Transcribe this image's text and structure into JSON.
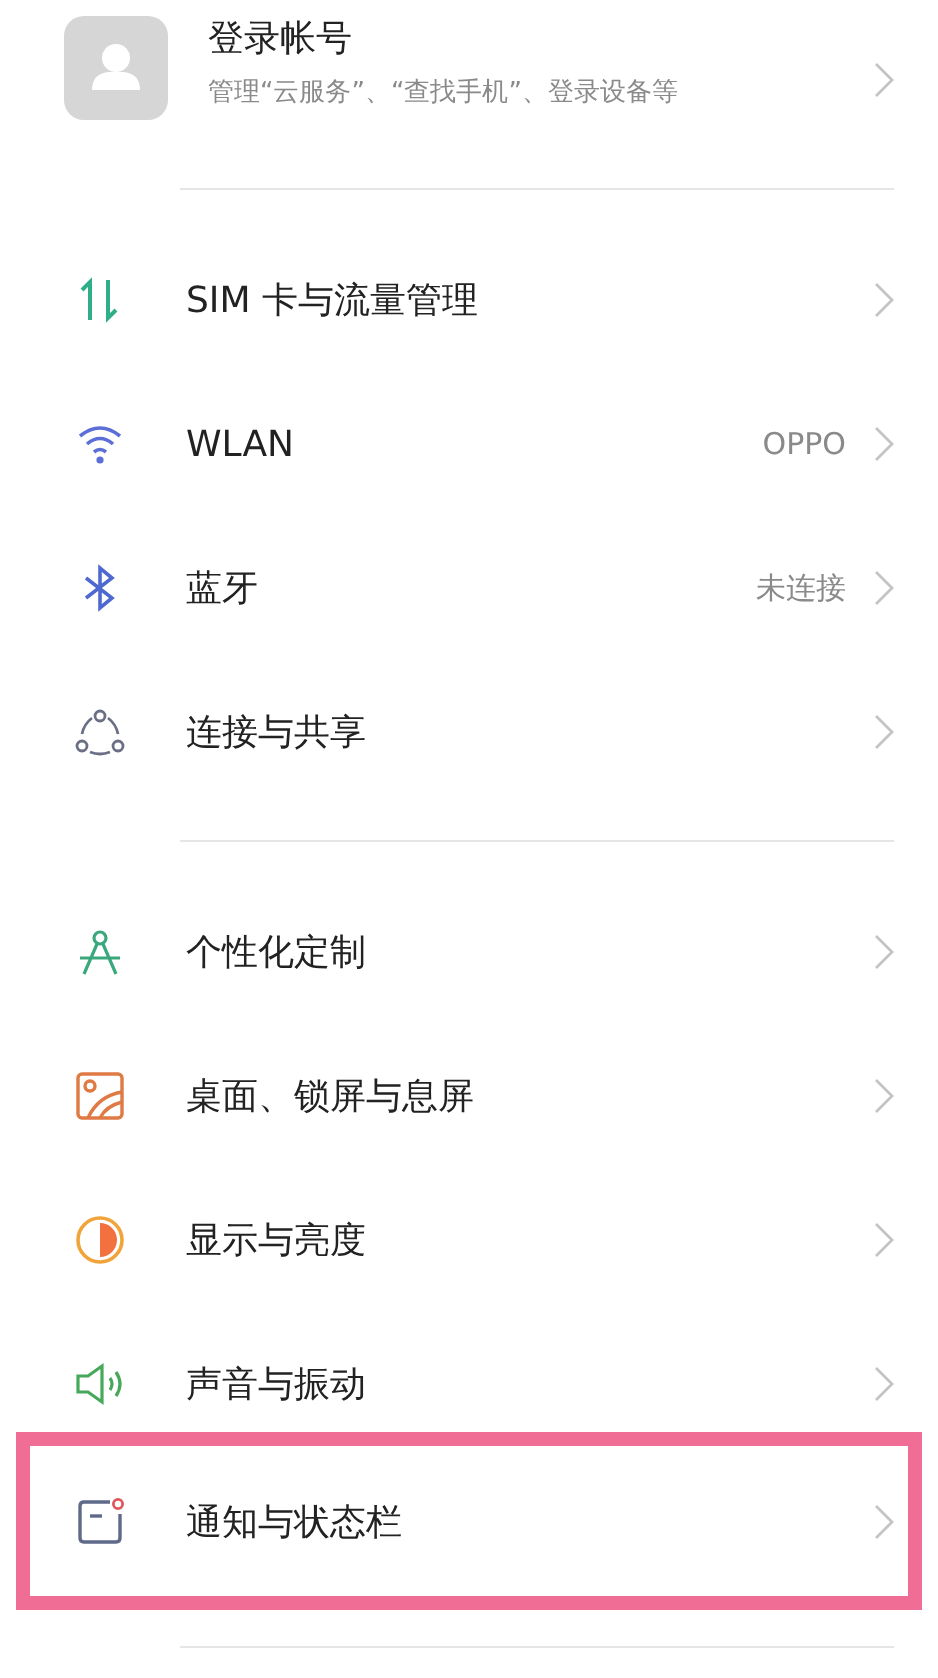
{
  "account": {
    "title": "登录帐号",
    "subtitle": "管理“云服务”、“查找手机”、登录设备等"
  },
  "groups": [
    {
      "items": [
        {
          "kind": "sim",
          "label": "SIM 卡与流量管理",
          "highlighted": false
        },
        {
          "kind": "wifi",
          "label": "WLAN",
          "value": "OPPO",
          "highlighted": false
        },
        {
          "kind": "bluetooth",
          "label": "蓝牙",
          "value": "未连接",
          "highlighted": false
        },
        {
          "kind": "share",
          "label": "连接与共享",
          "highlighted": false
        }
      ]
    },
    {
      "items": [
        {
          "kind": "compass",
          "label": "个性化定制",
          "highlighted": false
        },
        {
          "kind": "wallpaper",
          "label": "桌面、锁屏与息屏",
          "highlighted": false
        },
        {
          "kind": "display",
          "label": "显示与亮度",
          "highlighted": false
        },
        {
          "kind": "sound",
          "label": "声音与振动",
          "highlighted": false
        },
        {
          "kind": "notification",
          "label": "通知与状态栏",
          "highlighted": true
        }
      ]
    }
  ]
}
